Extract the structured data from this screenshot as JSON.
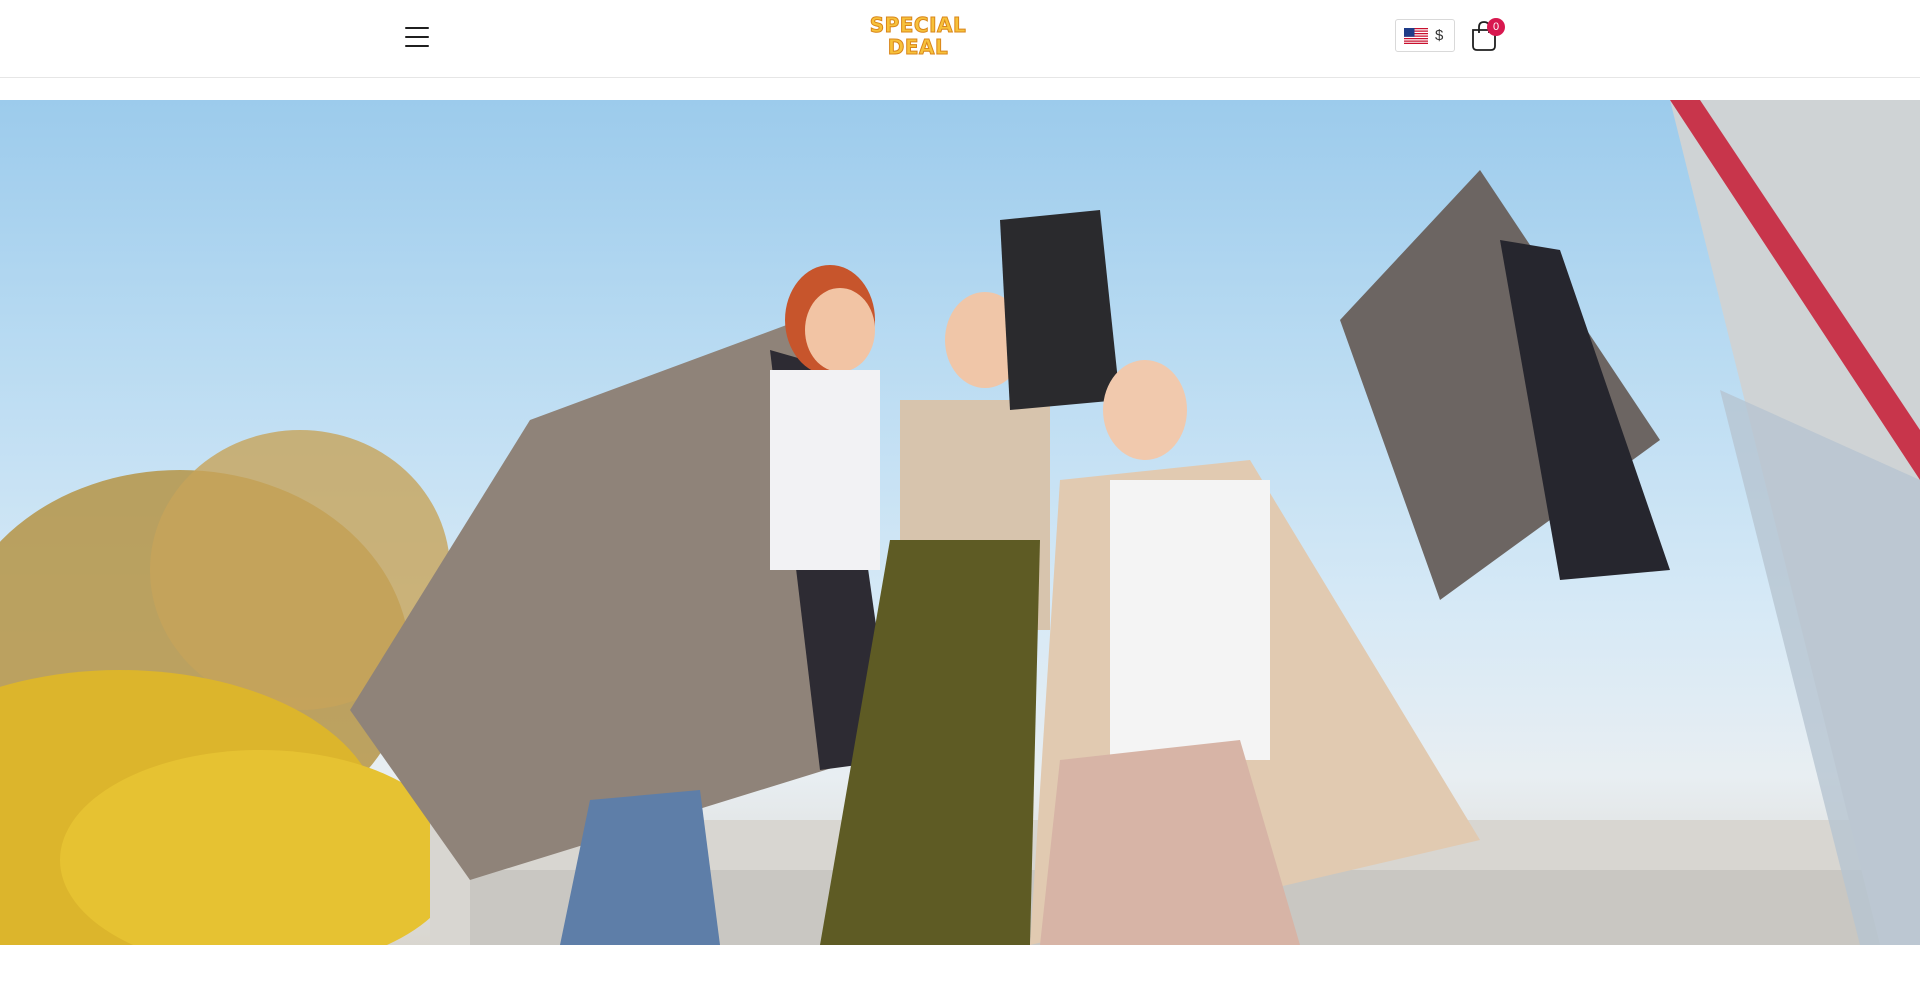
{
  "header": {
    "menu_icon": "hamburger-menu-icon",
    "logo": {
      "line1": "SPECIAL",
      "line2": "DEAL"
    },
    "currency": {
      "flag_icon": "us-flag-icon",
      "symbol": "$"
    },
    "cart": {
      "icon": "shopping-bag-icon",
      "count": "0"
    }
  },
  "hero": {
    "image": "hero-banner-image"
  },
  "colors": {
    "badge": "#d8184f",
    "logo_fill": "#f7c13a",
    "logo_outline": "#d9861a"
  }
}
